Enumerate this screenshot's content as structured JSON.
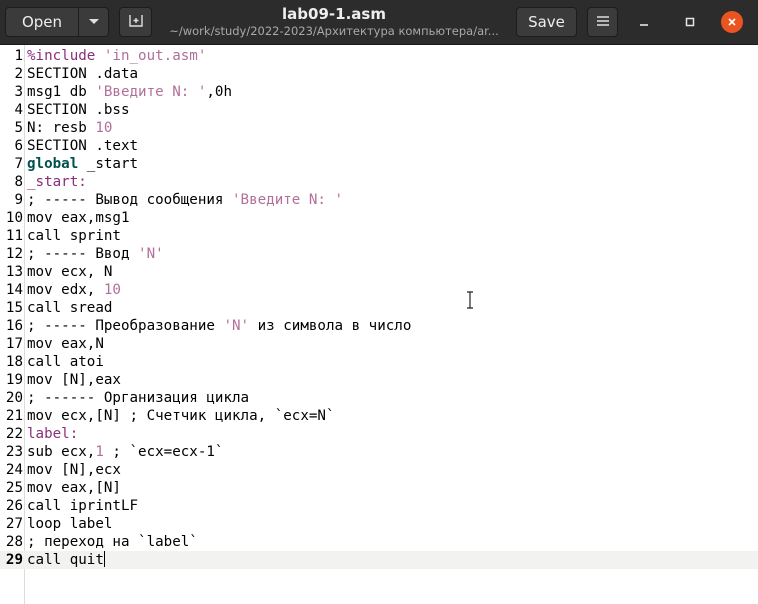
{
  "header": {
    "open_label": "Open",
    "save_label": "Save",
    "title": "lab09-1.asm",
    "subtitle": "~/work/study/2022-2023/Архитектура компьютера/ar..."
  },
  "icons": {
    "open_dropdown": "chevron-down-icon",
    "new_tab": "new-document-icon",
    "menu": "hamburger-menu-icon",
    "minimize": "minimize-icon",
    "maximize": "maximize-icon",
    "close": "close-icon",
    "cursor": "i-beam-cursor-icon"
  },
  "colors": {
    "header_bg": "#2c2c2c",
    "close_button": "#e95420",
    "string_literal": "#b0709a",
    "keyword": "#005050",
    "current_line": "#f2f2f0"
  },
  "editor": {
    "current_line": 29,
    "lines": [
      {
        "num": "1",
        "tokens": [
          {
            "t": "%include ",
            "c": "lbl"
          },
          {
            "t": "'in_out.asm'",
            "c": "s"
          }
        ]
      },
      {
        "num": "2",
        "tokens": [
          {
            "t": "SECTION .data"
          }
        ]
      },
      {
        "num": "3",
        "tokens": [
          {
            "t": "msg1 db "
          },
          {
            "t": "'Введите N: '",
            "c": "s"
          },
          {
            "t": ",0h"
          }
        ]
      },
      {
        "num": "4",
        "tokens": [
          {
            "t": "SECTION .bss"
          }
        ]
      },
      {
        "num": "5",
        "tokens": [
          {
            "t": "N: resb "
          },
          {
            "t": "10",
            "c": "n"
          }
        ]
      },
      {
        "num": "6",
        "tokens": [
          {
            "t": "SECTION .text"
          }
        ]
      },
      {
        "num": "7",
        "tokens": [
          {
            "t": "global",
            "c": "k"
          },
          {
            "t": " _start"
          }
        ]
      },
      {
        "num": "8",
        "tokens": [
          {
            "t": "_start:",
            "c": "lbl"
          }
        ]
      },
      {
        "num": "9",
        "tokens": [
          {
            "t": "; ----- Вывод сообщения "
          },
          {
            "t": "'Введите N: '",
            "c": "s"
          }
        ]
      },
      {
        "num": "10",
        "tokens": [
          {
            "t": "mov eax,msg1"
          }
        ]
      },
      {
        "num": "11",
        "tokens": [
          {
            "t": "call sprint"
          }
        ]
      },
      {
        "num": "12",
        "tokens": [
          {
            "t": "; ----- Ввод "
          },
          {
            "t": "'N'",
            "c": "s"
          }
        ]
      },
      {
        "num": "13",
        "tokens": [
          {
            "t": "mov ecx, N"
          }
        ]
      },
      {
        "num": "14",
        "tokens": [
          {
            "t": "mov edx, "
          },
          {
            "t": "10",
            "c": "n"
          }
        ]
      },
      {
        "num": "15",
        "tokens": [
          {
            "t": "call sread"
          }
        ]
      },
      {
        "num": "16",
        "tokens": [
          {
            "t": "; ----- Преобразование "
          },
          {
            "t": "'N'",
            "c": "s"
          },
          {
            "t": " из символа в число"
          }
        ]
      },
      {
        "num": "17",
        "tokens": [
          {
            "t": "mov eax,N"
          }
        ]
      },
      {
        "num": "18",
        "tokens": [
          {
            "t": "call atoi"
          }
        ]
      },
      {
        "num": "19",
        "tokens": [
          {
            "t": "mov [N],eax"
          }
        ]
      },
      {
        "num": "20",
        "tokens": [
          {
            "t": "; ------ Организация цикла"
          }
        ]
      },
      {
        "num": "21",
        "tokens": [
          {
            "t": "mov ecx,[N] ; Счетчик цикла, `ecx=N`"
          }
        ]
      },
      {
        "num": "22",
        "tokens": [
          {
            "t": "label:",
            "c": "lbl"
          }
        ]
      },
      {
        "num": "23",
        "tokens": [
          {
            "t": "sub ecx,"
          },
          {
            "t": "1",
            "c": "n"
          },
          {
            "t": " ; `ecx=ecx-1`"
          }
        ]
      },
      {
        "num": "24",
        "tokens": [
          {
            "t": "mov [N],ecx"
          }
        ]
      },
      {
        "num": "25",
        "tokens": [
          {
            "t": "mov eax,[N]"
          }
        ]
      },
      {
        "num": "26",
        "tokens": [
          {
            "t": "call iprintLF"
          }
        ]
      },
      {
        "num": "27",
        "tokens": [
          {
            "t": "loop label"
          }
        ]
      },
      {
        "num": "28",
        "tokens": [
          {
            "t": "; переход на `label`"
          }
        ]
      },
      {
        "num": "29",
        "tokens": [
          {
            "t": "call quit"
          }
        ]
      }
    ]
  }
}
